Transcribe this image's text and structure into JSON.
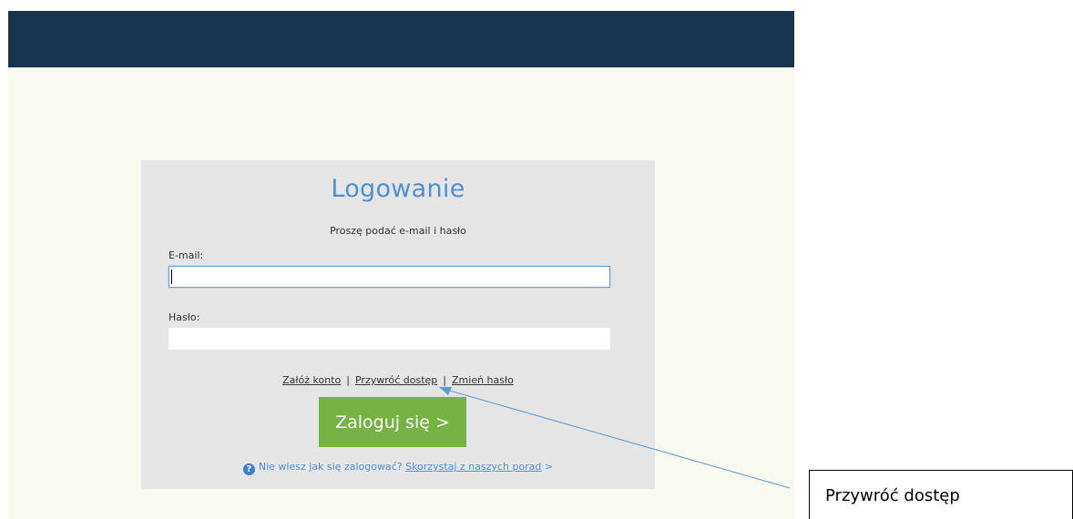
{
  "login": {
    "title": "Logowanie",
    "subtitle": "Proszę podać e-mail i hasło",
    "email_label": "E-mail:",
    "email_value": "",
    "password_label": "Hasło:",
    "password_value": "",
    "links": {
      "register": "Załóż konto",
      "restore_access": "Przywróć dostęp",
      "change_password": "Zmień hasło",
      "separator": "|"
    },
    "submit_label": "Zaloguj się >",
    "help": {
      "question": "Nie wiesz jak się zalogować?",
      "link": "Skorzystaj z naszych porad",
      "suffix": ">"
    }
  },
  "annotation": {
    "callout_text": "Przywróć dostęp"
  },
  "colors": {
    "header": "#19344f",
    "page_background": "#f8f9ef",
    "panel": "#e5e5e5",
    "title": "#4f8fd6",
    "button": "#76b244",
    "arrow": "#5b9bd5"
  }
}
